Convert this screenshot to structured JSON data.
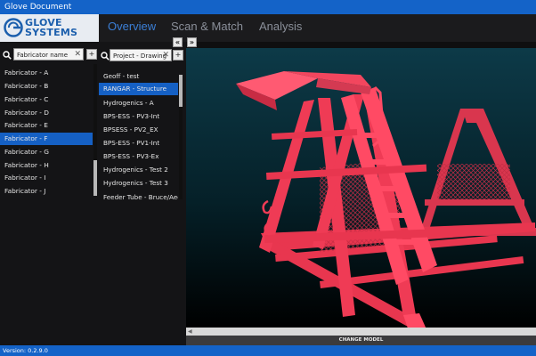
{
  "window": {
    "title": "Glove Document"
  },
  "brand": {
    "logo_text_line1": "GLOVE",
    "logo_text_line2": "SYSTEMS"
  },
  "tabs": [
    {
      "label": "Overview",
      "active": true
    },
    {
      "label": "Scan & Match",
      "active": false
    },
    {
      "label": "Analysis",
      "active": false
    }
  ],
  "fabricator_filter": {
    "value": "Fabricator name",
    "clear": "✕",
    "add": "+"
  },
  "project_filter": {
    "value": "Project - Drawing",
    "clear": "✕",
    "add": "+"
  },
  "collapse_buttons": {
    "left": "«",
    "right": "»"
  },
  "fabricators": [
    "Fabricator - A",
    "Fabricator - B",
    "Fabricator - C",
    "Fabricator - D",
    "Fabricator - E",
    "Fabricator - F",
    "Fabricator - G",
    "Fabricator - H",
    "Fabricator - I",
    "Fabricator - J"
  ],
  "fabricators_selected": 5,
  "projects": [
    "Geoff - test",
    "RANGAR - Structure",
    "Hydrogenics - A",
    "BPS-ESS - PV3-Int",
    "BPSESS - PV2_EX",
    "BPS-ESS - PV1-Int",
    "BPS-ESS - PV3-Ex",
    "Hydrogenics - Test 2",
    "Hydrogenics - Test 3",
    "Feeder Tube - Bruce/Aecon"
  ],
  "projects_selected": 1,
  "viewer": {
    "change_model_label": "CHANGE MODEL"
  },
  "status": {
    "version": "Version: 0.2.9.0"
  },
  "colors": {
    "accent": "#1463c8",
    "model": "#ef3b55",
    "viewport_top": "#0a2f3c",
    "viewport_bottom": "#000000"
  },
  "icons": {
    "search": "search-icon",
    "clear": "close-icon",
    "add": "plus-icon",
    "collapse": "chevron-double-left-icon",
    "expand": "chevron-double-right-icon"
  }
}
